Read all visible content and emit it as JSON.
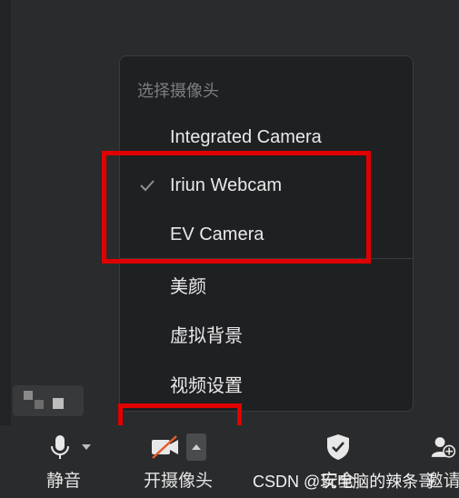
{
  "menu": {
    "title": "选择摄像头",
    "cameras": [
      {
        "label": "Integrated Camera",
        "selected": false
      },
      {
        "label": "Iriun Webcam",
        "selected": true
      },
      {
        "label": "EV Camera",
        "selected": false
      }
    ],
    "options": [
      "美颜",
      "虚拟背景",
      "视频设置"
    ]
  },
  "toolbar": {
    "mute_label": "静音",
    "camera_label": "开摄像头",
    "security_label": "安全",
    "invite_label": "邀请"
  },
  "watermark": "CSDN @玩电脑的辣条哥",
  "colors": {
    "highlight": "#e00000",
    "menu_bg": "#1f2022",
    "toolbar_bg": "#2a2b2d"
  }
}
